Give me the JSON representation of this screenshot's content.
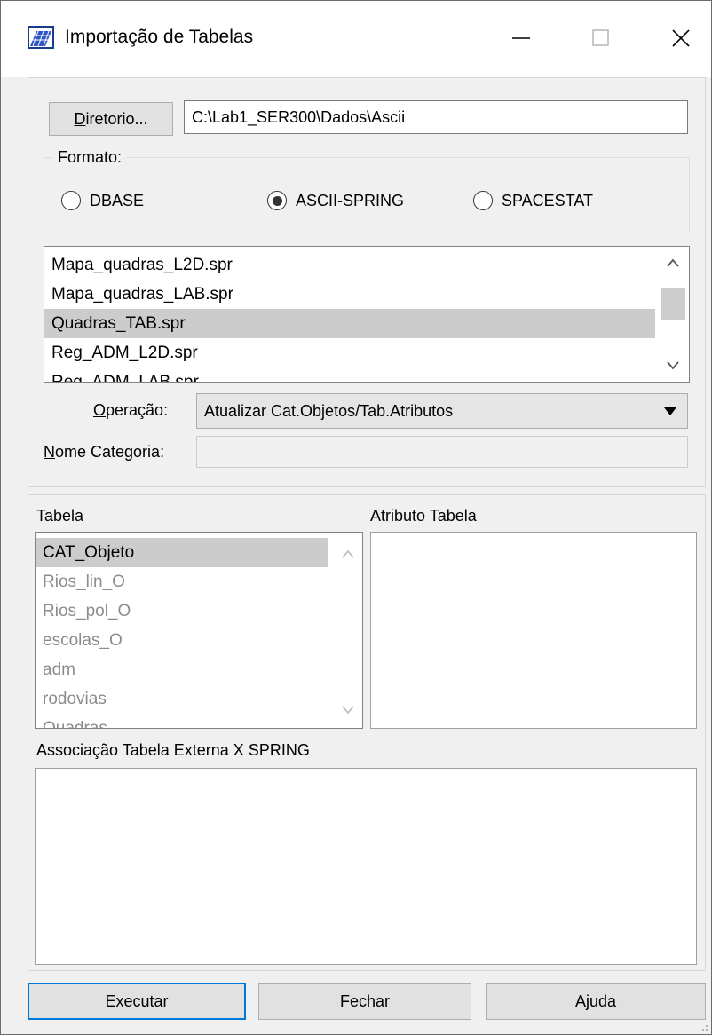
{
  "window": {
    "title": "Importação de Tabelas"
  },
  "top": {
    "dir_button_label": "Diretorio...",
    "dir_button_mnemonic": "D",
    "dir_button_rest": "iretorio...",
    "dir_path": "C:\\Lab1_SER300\\Dados\\Ascii",
    "format_label": "Formato:",
    "formats": [
      {
        "label": "DBASE",
        "selected": false
      },
      {
        "label": "ASCII-SPRING",
        "selected": true
      },
      {
        "label": "SPACESTAT",
        "selected": false
      }
    ],
    "files": [
      {
        "name": "Mapa_quadras_L2D.spr",
        "selected": false
      },
      {
        "name": "Mapa_quadras_LAB.spr",
        "selected": false
      },
      {
        "name": "Quadras_TAB.spr",
        "selected": true
      },
      {
        "name": "Reg_ADM_L2D.spr",
        "selected": false
      },
      {
        "name": "Reg_ADM_LAB.spr",
        "selected": false
      }
    ],
    "operacao_label": "Operação:",
    "operacao_mnemonic": "O",
    "operacao_rest": "peração:",
    "operacao_value": "Atualizar Cat.Objetos/Tab.Atributos",
    "nome_categoria_label": "Nome Categoria:",
    "nome_categoria_mnemonic": "N",
    "nome_categoria_rest": "ome Categoria:",
    "nome_categoria_value": ""
  },
  "bottom": {
    "tabela_label": "Tabela",
    "atributo_label": "Atributo Tabela",
    "tabelas": [
      {
        "name": "CAT_Objeto",
        "selected": true
      },
      {
        "name": "Rios_lin_O",
        "selected": false
      },
      {
        "name": "Rios_pol_O",
        "selected": false
      },
      {
        "name": "escolas_O",
        "selected": false
      },
      {
        "name": "adm",
        "selected": false
      },
      {
        "name": "rodovias",
        "selected": false
      },
      {
        "name": "Quadras",
        "selected": false
      }
    ],
    "associacao_label": "Associação Tabela Externa X SPRING"
  },
  "buttons": {
    "executar": "Executar",
    "fechar": "Fechar",
    "ajuda": "Ajuda"
  },
  "icons": {
    "app": "spring-app-icon",
    "minimize": "minimize-icon",
    "maximize": "maximize-icon",
    "close": "close-icon"
  },
  "colors": {
    "accent": "#0078d7",
    "selection": "#cccccc",
    "panel_bg": "#f0f0f0"
  }
}
